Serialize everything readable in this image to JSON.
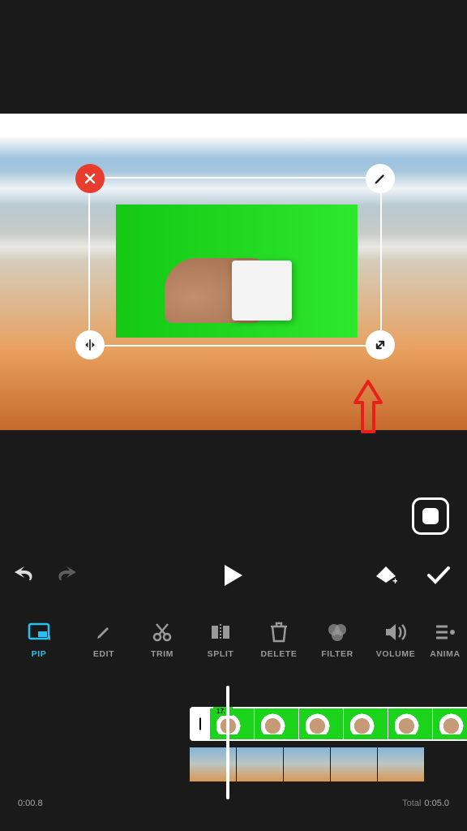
{
  "pip_overlay": {
    "duration_badge": "17.7"
  },
  "toolbar": [
    {
      "key": "pip",
      "label": "PIP",
      "active": true
    },
    {
      "key": "edit",
      "label": "EDIT"
    },
    {
      "key": "trim",
      "label": "TRIM"
    },
    {
      "key": "split",
      "label": "SPLIT"
    },
    {
      "key": "delete",
      "label": "DELETE"
    },
    {
      "key": "filter",
      "label": "FILTER"
    },
    {
      "key": "volume",
      "label": "VOLUME"
    },
    {
      "key": "animation",
      "label": "ANIMA"
    }
  ],
  "pip_track_handle": "|",
  "time": {
    "current": "0:00.8",
    "total_label": "Total",
    "total": "0:05.0"
  }
}
